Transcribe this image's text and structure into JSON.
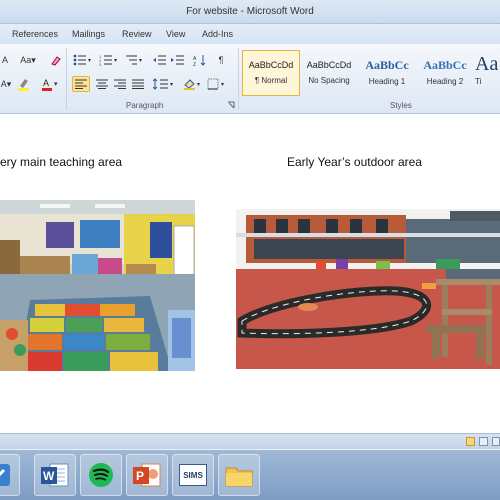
{
  "window": {
    "title": "For website - Microsoft Word"
  },
  "tabs": [
    {
      "label": "References"
    },
    {
      "label": "Mailings"
    },
    {
      "label": "Review"
    },
    {
      "label": "View"
    },
    {
      "label": "Add-Ins"
    }
  ],
  "ribbon": {
    "groups": {
      "paragraph": "Paragraph",
      "styles": "Styles"
    },
    "styles": [
      {
        "sample": "AaBbCcDd",
        "name": "¶ Normal",
        "selected": true
      },
      {
        "sample": "AaBbCcDd",
        "name": "No Spacing"
      },
      {
        "sample": "AaBbCc",
        "name": "Heading 1"
      },
      {
        "sample": "AaBbCc",
        "name": "Heading 2"
      },
      {
        "sample": "AaB",
        "name": "Ti"
      }
    ]
  },
  "document": {
    "captions": {
      "left": "ery main teaching area",
      "right": "Early Year’s outdoor area"
    }
  },
  "taskbar": {
    "sims_label": "SIMS"
  },
  "colors": {
    "accent": "#2b579a",
    "ribbon_selected": "#fce39a",
    "outdoor_surface": "#c7574a",
    "taskbar": "#8aa7cc"
  }
}
